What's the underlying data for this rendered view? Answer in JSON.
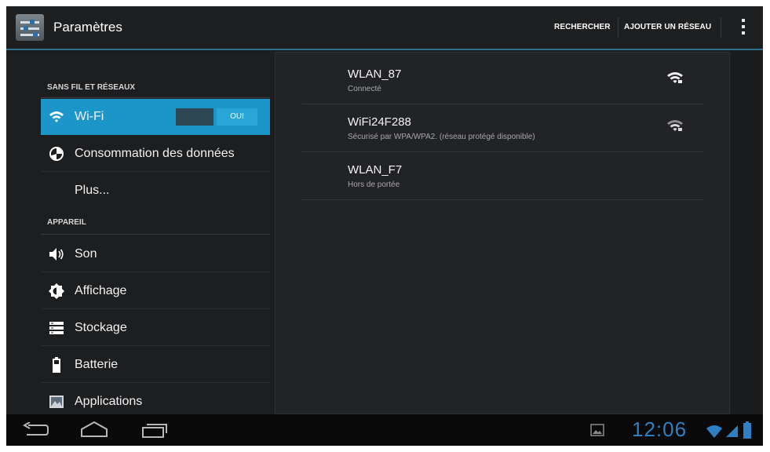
{
  "action_bar": {
    "title": "Paramètres",
    "actions": [
      "RECHERCHER",
      "AJOUTER UN RÉSEAU"
    ],
    "overflow_icon": "overflow-menu-icon"
  },
  "sidebar": {
    "section_wireless": "SANS FIL ET RÉSEAUX",
    "section_device": "APPAREIL",
    "wifi_item": {
      "label": "Wi-Fi",
      "toggle_state": "OUI",
      "icon": "wifi-icon"
    },
    "items": [
      {
        "label": "Consommation des données",
        "icon": "data-usage-icon"
      },
      {
        "label": "Plus...",
        "icon": ""
      },
      {
        "label": "Son",
        "icon": "speaker-icon"
      },
      {
        "label": "Affichage",
        "icon": "brightness-icon"
      },
      {
        "label": "Stockage",
        "icon": "storage-icon"
      },
      {
        "label": "Batterie",
        "icon": "battery-icon"
      },
      {
        "label": "Applications",
        "icon": "apps-icon"
      }
    ]
  },
  "networks": [
    {
      "ssid": "WLAN_87",
      "status": "Connecté"
    },
    {
      "ssid": "WiFi24F288",
      "status": "Sécurisé par WPA/WPA2. (réseau protégé disponible)"
    },
    {
      "ssid": "WLAN_F7",
      "status": "Hors de portée"
    }
  ],
  "status_bar": {
    "time": "12:06"
  },
  "colors": {
    "accent": "#1c96c8",
    "toggle_on": "#2aa6d6",
    "clock": "#2f80c2",
    "background": "#1b1c1e"
  }
}
